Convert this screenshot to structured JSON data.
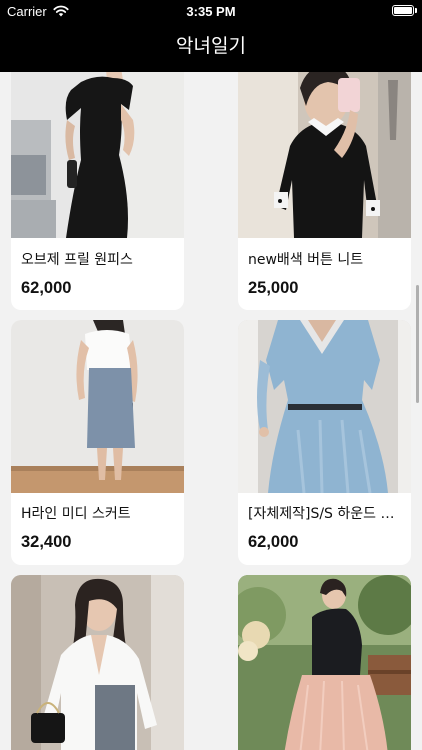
{
  "status_bar": {
    "carrier": "Carrier",
    "time": "3:35 PM"
  },
  "nav": {
    "title": "악녀일기"
  },
  "products": [
    {
      "name": "오브제 프릴 원피스",
      "price": "62,000",
      "image": "black-dress-photo"
    },
    {
      "name": "new배색 버튼 니트",
      "price": "25,000",
      "image": "black-knit-photo"
    },
    {
      "name": "H라인 미디 스커트",
      "price": "32,400",
      "image": "blue-skirt-photo"
    },
    {
      "name": "[자체제작]S/S 하운드 체…",
      "price": "62,000",
      "image": "blue-dress-photo"
    },
    {
      "name": "",
      "price": "",
      "image": "white-jacket-photo"
    },
    {
      "name": "",
      "price": "",
      "image": "pink-tulle-skirt-photo"
    }
  ]
}
